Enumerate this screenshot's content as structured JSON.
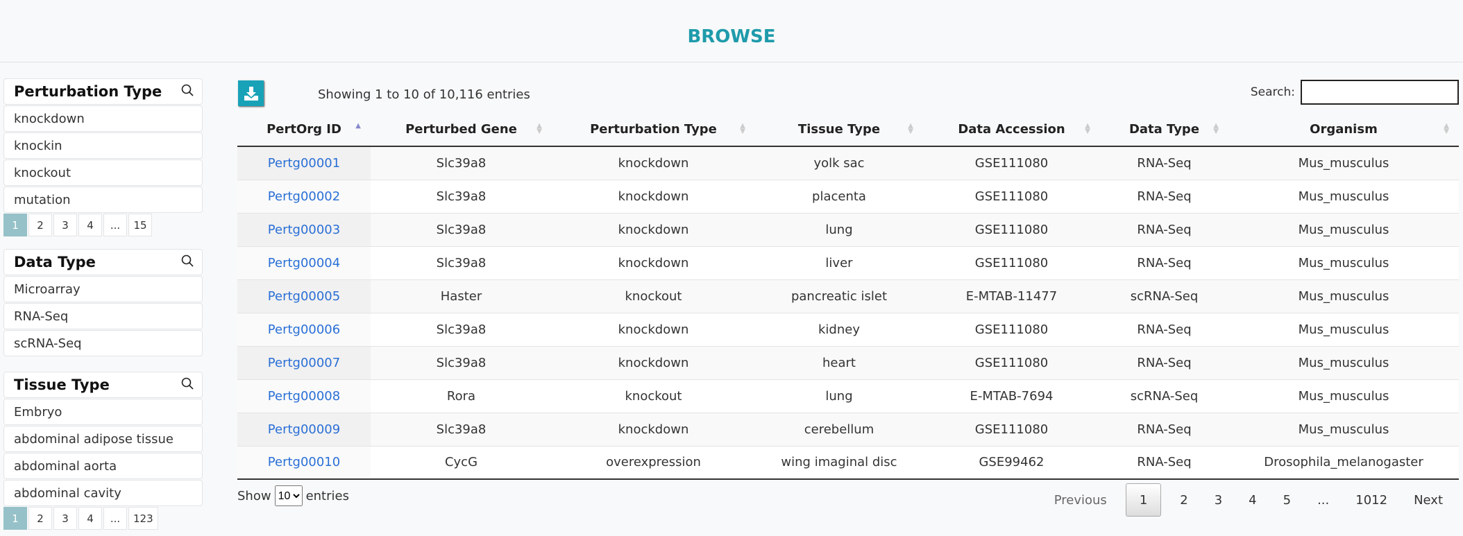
{
  "title": "BROWSE",
  "sidebar": [
    {
      "heading": "Perturbation Type",
      "items": [
        "knockdown",
        "knockin",
        "knockout",
        "mutation"
      ],
      "pages": [
        "1",
        "2",
        "3",
        "4",
        "...",
        "15"
      ]
    },
    {
      "heading": "Data Type",
      "items": [
        "Microarray",
        "RNA-Seq",
        "scRNA-Seq"
      ],
      "pages": []
    },
    {
      "heading": "Tissue Type",
      "items": [
        "Embryo",
        "abdominal adipose tissue",
        "abdominal aorta",
        "abdominal cavity"
      ],
      "pages": [
        "1",
        "2",
        "3",
        "4",
        "...",
        "123"
      ]
    }
  ],
  "table": {
    "info": "Showing 1 to 10 of 10,116 entries",
    "search_label": "Search:",
    "search_value": "",
    "columns": [
      "PertOrg ID",
      "Perturbed Gene",
      "Perturbation Type",
      "Tissue Type",
      "Data Accession",
      "Data Type",
      "Organism"
    ],
    "rows": [
      [
        "Pertg00001",
        "Slc39a8",
        "knockdown",
        "yolk sac",
        "GSE111080",
        "RNA-Seq",
        "Mus_musculus"
      ],
      [
        "Pertg00002",
        "Slc39a8",
        "knockdown",
        "placenta",
        "GSE111080",
        "RNA-Seq",
        "Mus_musculus"
      ],
      [
        "Pertg00003",
        "Slc39a8",
        "knockdown",
        "lung",
        "GSE111080",
        "RNA-Seq",
        "Mus_musculus"
      ],
      [
        "Pertg00004",
        "Slc39a8",
        "knockdown",
        "liver",
        "GSE111080",
        "RNA-Seq",
        "Mus_musculus"
      ],
      [
        "Pertg00005",
        "Haster",
        "knockout",
        "pancreatic islet",
        "E-MTAB-11477",
        "scRNA-Seq",
        "Mus_musculus"
      ],
      [
        "Pertg00006",
        "Slc39a8",
        "knockdown",
        "kidney",
        "GSE111080",
        "RNA-Seq",
        "Mus_musculus"
      ],
      [
        "Pertg00007",
        "Slc39a8",
        "knockdown",
        "heart",
        "GSE111080",
        "RNA-Seq",
        "Mus_musculus"
      ],
      [
        "Pertg00008",
        "Rora",
        "knockout",
        "lung",
        "E-MTAB-7694",
        "scRNA-Seq",
        "Mus_musculus"
      ],
      [
        "Pertg00009",
        "Slc39a8",
        "knockdown",
        "cerebellum",
        "GSE111080",
        "RNA-Seq",
        "Mus_musculus"
      ],
      [
        "Pertg00010",
        "CycG",
        "overexpression",
        "wing imaginal disc",
        "GSE99462",
        "RNA-Seq",
        "Drosophila_melanogaster"
      ]
    ],
    "show_label": "Show",
    "show_value": "10",
    "entries_label": "entries",
    "pagination": {
      "previous": "Previous",
      "pages": [
        "1",
        "2",
        "3",
        "4",
        "5",
        "...",
        "1012"
      ],
      "current": "1",
      "next": "Next"
    }
  },
  "colors": {
    "accent": "#17a2b8",
    "title": "#1e9bab",
    "link": "#2a6fd6"
  }
}
